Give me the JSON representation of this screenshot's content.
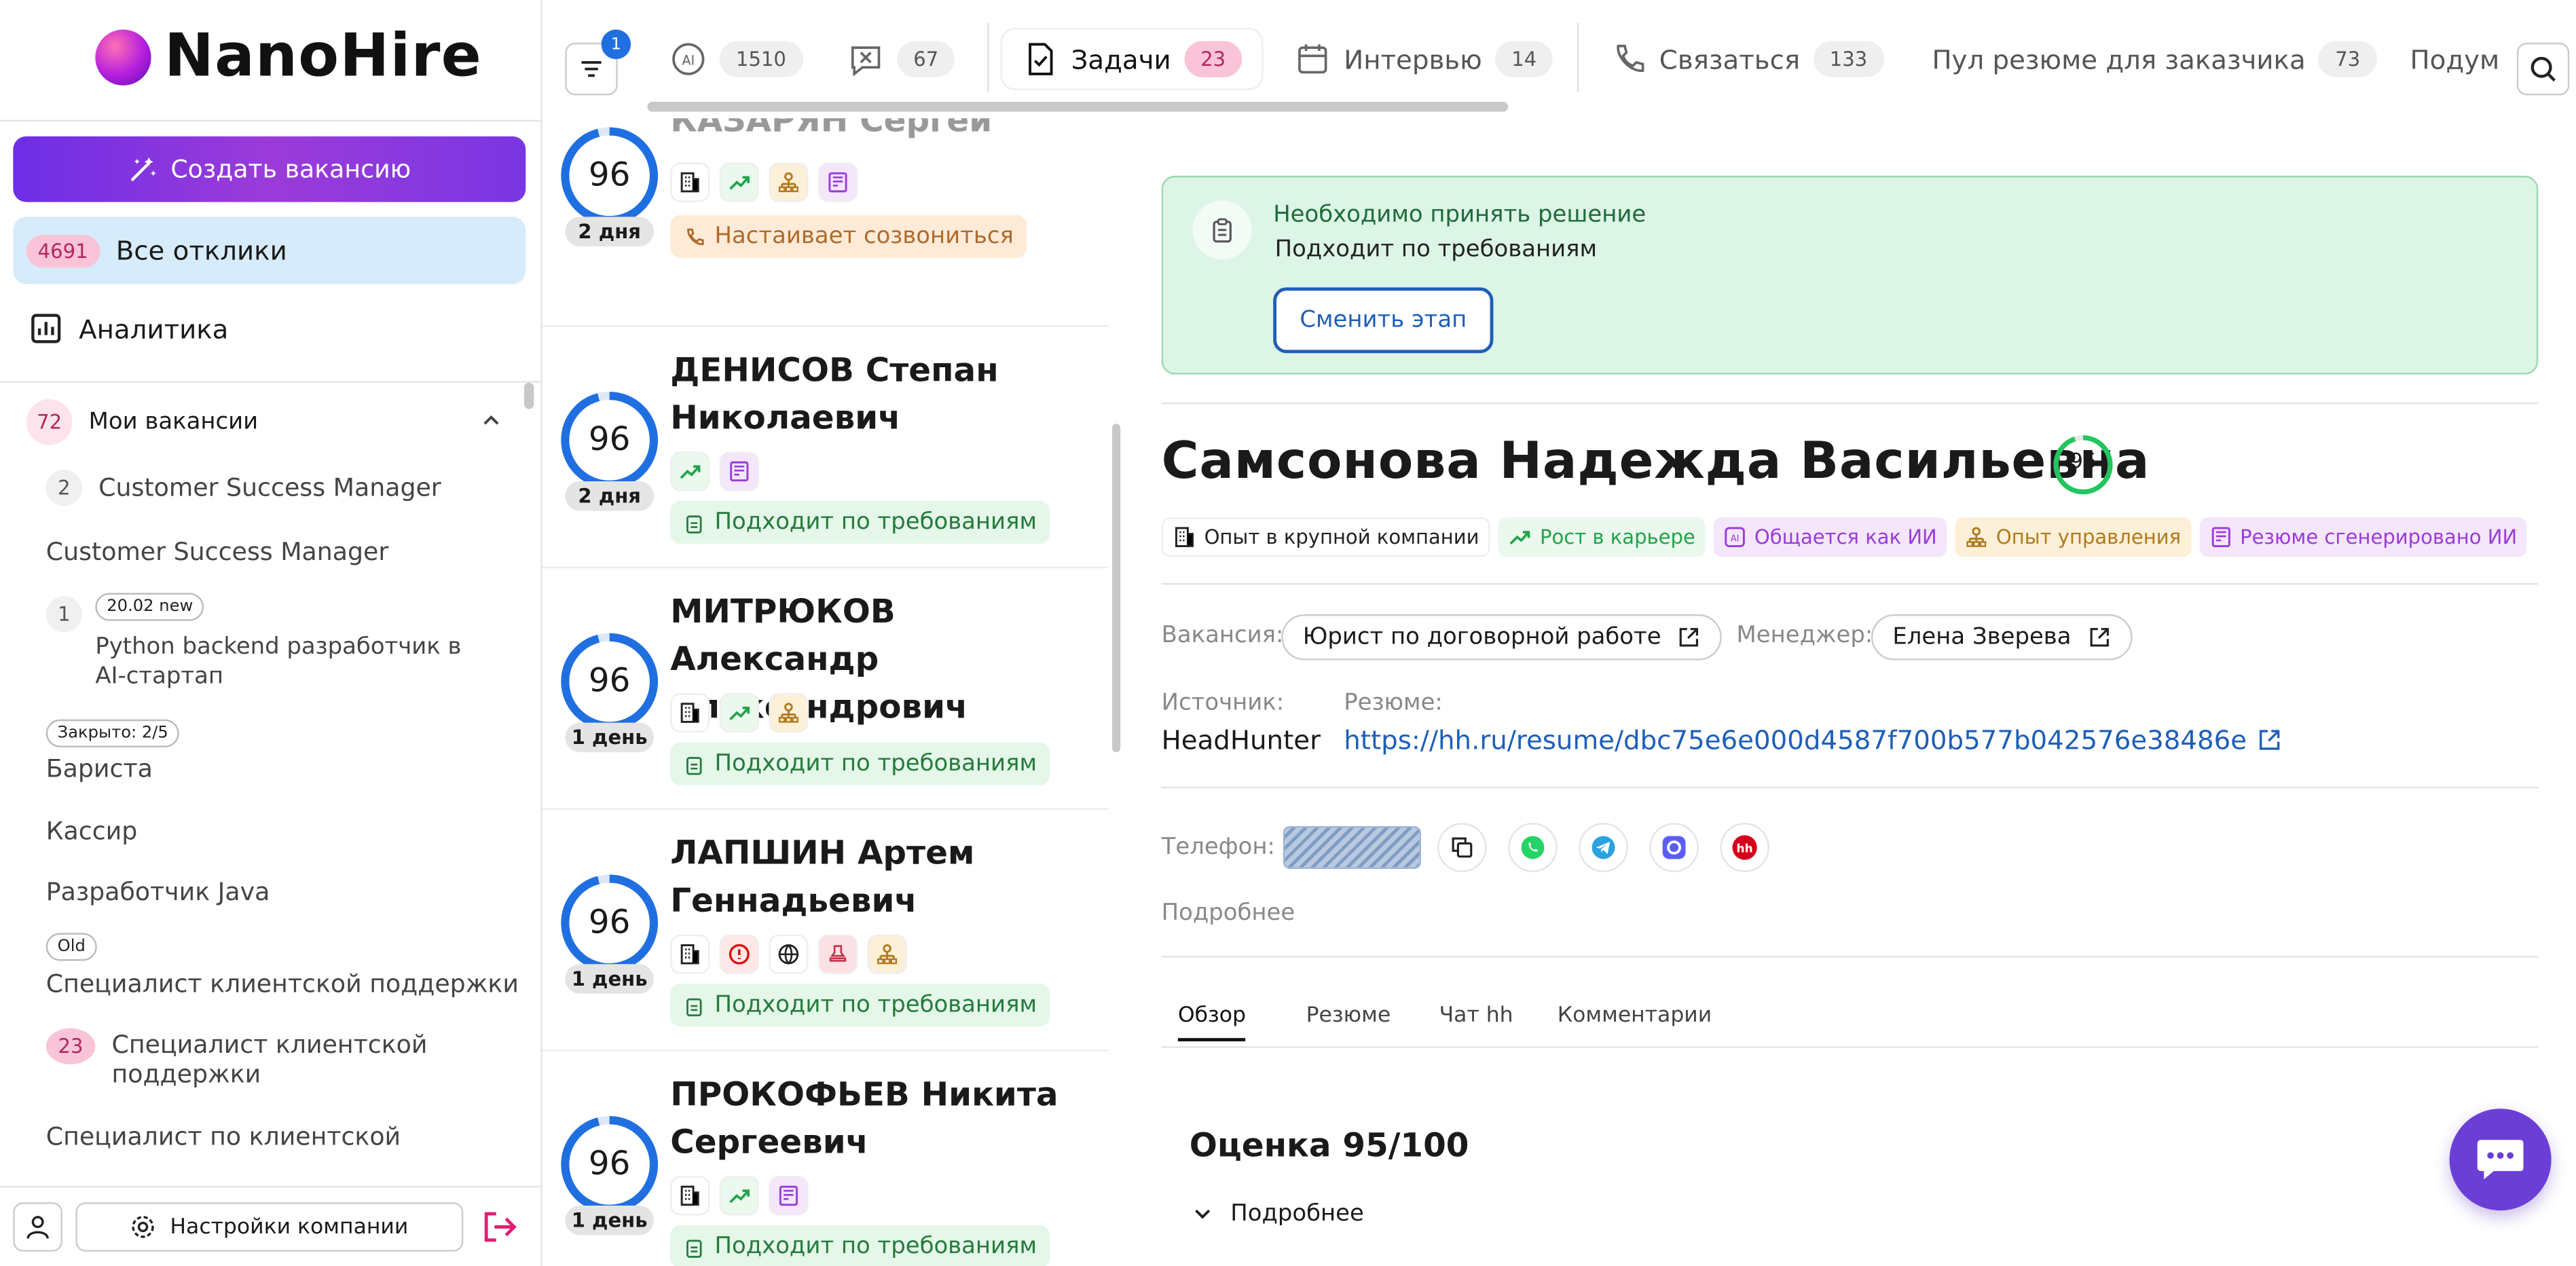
{
  "app": {
    "logo_text": "NanoHire"
  },
  "sidebar": {
    "create_vacancy": "Создать вакансию",
    "all_responses_count": "4691",
    "all_responses": "Все отклики",
    "analytics": "Аналитика",
    "my_vacancies_count": "72",
    "my_vacancies": "Мои вакансии",
    "vacancies": [
      {
        "count": "2",
        "title": "Customer Success Manager"
      },
      {
        "title": "Customer Success Manager"
      },
      {
        "count": "1",
        "tag": "20.02 new",
        "title": "Python backend разработчик в AI-стартап"
      },
      {
        "tag": "Закрыто: 2/5",
        "title": "Бариста"
      },
      {
        "title": "Кассир"
      },
      {
        "title": "Разработчик Java"
      },
      {
        "tag": "Old",
        "title": "Специалист клиентской поддержки"
      },
      {
        "count": "23",
        "title": "Специалист клиентской поддержки"
      },
      {
        "title": "Специалист по клиентской"
      }
    ],
    "company_settings": "Настройки компании"
  },
  "topbar": {
    "filter_badge": "1",
    "tabs": [
      {
        "label": "",
        "count": "1510",
        "icon": "ai-icon"
      },
      {
        "label": "",
        "count": "67",
        "icon": "reject-icon"
      },
      {
        "label": "Задачи",
        "count": "23",
        "icon": "tasks-icon"
      },
      {
        "label": "Интервью",
        "count": "14",
        "icon": "calendar-icon"
      },
      {
        "label": "Связаться",
        "count": "133",
        "icon": "phone-icon"
      },
      {
        "label": "Пул резюме для заказчика",
        "count": "73"
      },
      {
        "label": "Подум"
      }
    ]
  },
  "candidates": [
    {
      "name": "КАЗАРЯН Сергей",
      "score": "96",
      "days": "2 дня",
      "status": "Настаивает созвониться",
      "status_type": "orange",
      "icons": [
        "company-icon",
        "growth-icon",
        "management-icon",
        "ai-resume-icon"
      ]
    },
    {
      "name": "ДЕНИСОВ Степан Николаевич",
      "score": "96",
      "days": "2 дня",
      "status": "Подходит по требованиям",
      "status_type": "green",
      "icons": [
        "growth-icon",
        "ai-resume-icon"
      ]
    },
    {
      "name": "МИТРЮКОВ Александр Александрович",
      "score": "96",
      "days": "1 день",
      "status": "Подходит по требованиям",
      "status_type": "green",
      "icons": [
        "company-icon",
        "growth-icon",
        "management-icon"
      ]
    },
    {
      "name": "ЛАПШИН Артем Геннадьевич",
      "score": "96",
      "days": "1 день",
      "status": "Подходит по требованиям",
      "status_type": "green",
      "icons": [
        "company-icon",
        "alert-icon",
        "globe-icon",
        "stamp-icon",
        "management-icon"
      ]
    },
    {
      "name": "ПРОКОФЬЕВ Никита Сергеевич",
      "score": "96",
      "days": "1 день",
      "status": "Подходит по требованиям",
      "status_type": "green",
      "icons": [
        "company-icon",
        "growth-icon",
        "ai-resume-icon"
      ]
    }
  ],
  "detail": {
    "decision_title": "Необходимо принять решение",
    "decision_sub": "Подходит по требованиям",
    "change_stage": "Сменить этап",
    "full_name": "Самсонова Надежда Васильевна",
    "score": "95",
    "traits": [
      {
        "label": "Опыт в крупной компании",
        "icon": "company-icon"
      },
      {
        "label": "Рост в карьере",
        "icon": "growth-icon"
      },
      {
        "label": "Общается как ИИ",
        "icon": "ai-icon"
      },
      {
        "label": "Опыт управления",
        "icon": "management-icon"
      },
      {
        "label": "Резюме сгенерировано ИИ",
        "icon": "ai-resume-icon"
      }
    ],
    "vacancy_label": "Вакансия:",
    "vacancy": "Юрист по договорной работе",
    "manager_label": "Менеджер:",
    "manager": "Елена Зверева",
    "source_label": "Источник:",
    "source": "HeadHunter",
    "resume_label": "Резюме:",
    "resume_link": "https://hh.ru/resume/dbc75e6e000d4587f700b577b042576e38486e",
    "phone_label": "Телефон:",
    "more": "Подробнее",
    "subtabs": [
      "Обзор",
      "Резюме",
      "Чат hh",
      "Комментарии"
    ],
    "score_title": "Оценка 95/100",
    "score_more": "Подробнее"
  },
  "colors": {
    "accent": "#6d2ee6",
    "blue": "#1e5fb8",
    "green": "#22c55e",
    "ring": "#1f6fe0"
  }
}
